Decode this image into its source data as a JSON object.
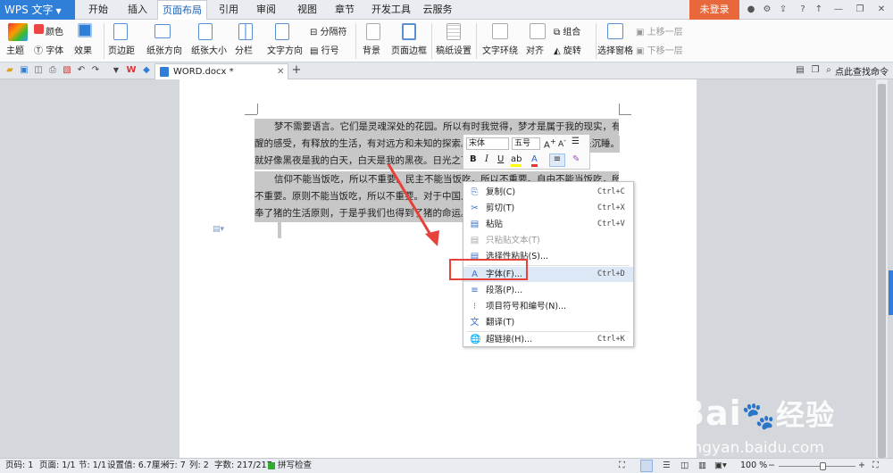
{
  "app": {
    "name": "WPS 文字",
    "login": "未登录"
  },
  "menu": [
    "开始",
    "插入",
    "页面布局",
    "引用",
    "审阅",
    "视图",
    "章节",
    "开发工具",
    "云服务"
  ],
  "menu_active": "页面布局",
  "ribbon": {
    "theme": "主题",
    "colors": "颜色",
    "font": "字体",
    "effects": "效果",
    "margins": "页边距",
    "orientation": "纸张方向",
    "size": "纸张大小",
    "columns": "分栏",
    "text_direction": "文字方向",
    "separator": "分隔符",
    "line_numbers": "行号",
    "background": "背景",
    "page_border": "页面边框",
    "manuscript": "稿纸设置",
    "wrap": "文字环绕",
    "align": "对齐",
    "rotate": "旋转",
    "group": "组合",
    "select_pane": "选择窗格",
    "bring_forward": "上移一层",
    "send_backward": "下移一层"
  },
  "tab": {
    "filename": "WORD.docx *"
  },
  "search": "点此查找命令",
  "document": {
    "lines": [
      "梦不需要语言。它们是灵魂深处的花园。所以有时我觉得，梦才是属于我的现实，有清",
      "醒的感受，有释放的生活，有对远方和未知的探索。",
      "就好像黑夜是我的白天，白天是我的黑夜。日光之下",
      "信仰不能当饭吃，所以不重要。民主不能当饭吃，所以不重要。自由不能当饭吃，所以",
      "不重要。原则不能当饭吃，所以不重要。对于中国人",
      "奉了猪的生活原则，于是乎我们也得到了猪的命运。"
    ],
    "tail_frag": "是沉睡。"
  },
  "minitoolbar": {
    "font": "宋体",
    "size": "五号"
  },
  "context_menu": [
    {
      "label": "复制(C)",
      "shortcut": "Ctrl+C",
      "icon": "copy-icon",
      "disabled": false
    },
    {
      "label": "剪切(T)",
      "shortcut": "Ctrl+X",
      "icon": "cut-icon",
      "disabled": false
    },
    {
      "label": "粘贴",
      "shortcut": "Ctrl+V",
      "icon": "paste-icon",
      "disabled": false
    },
    {
      "label": "只粘贴文本(T)",
      "shortcut": "",
      "icon": "paste-text-icon",
      "disabled": true
    },
    {
      "label": "选择性粘贴(S)...",
      "shortcut": "",
      "icon": "paste-special-icon",
      "disabled": false
    },
    {
      "label": "字体(F)...",
      "shortcut": "Ctrl+D",
      "icon": "font-icon",
      "disabled": false
    },
    {
      "label": "段落(P)...",
      "shortcut": "",
      "icon": "paragraph-icon",
      "disabled": false
    },
    {
      "label": "项目符号和编号(N)...",
      "shortcut": "",
      "icon": "bullets-icon",
      "disabled": false
    },
    {
      "label": "翻译(T)",
      "shortcut": "",
      "icon": "translate-icon",
      "disabled": false
    },
    {
      "label": "超链接(H)...",
      "shortcut": "Ctrl+K",
      "icon": "hyperlink-icon",
      "disabled": false
    }
  ],
  "status": {
    "page_no": "页码: 1",
    "pages": "页面: 1/1",
    "section": "节: 1/1",
    "setting": "设置值: 6.7厘米",
    "row": "行: 7",
    "col": "列: 2",
    "words": "字数: 217/217",
    "spell": "拼写检查",
    "zoom": "100 %"
  },
  "watermark": {
    "brand": "Bai",
    "brand2": "经验",
    "url": "jingyan.baidu.com"
  }
}
